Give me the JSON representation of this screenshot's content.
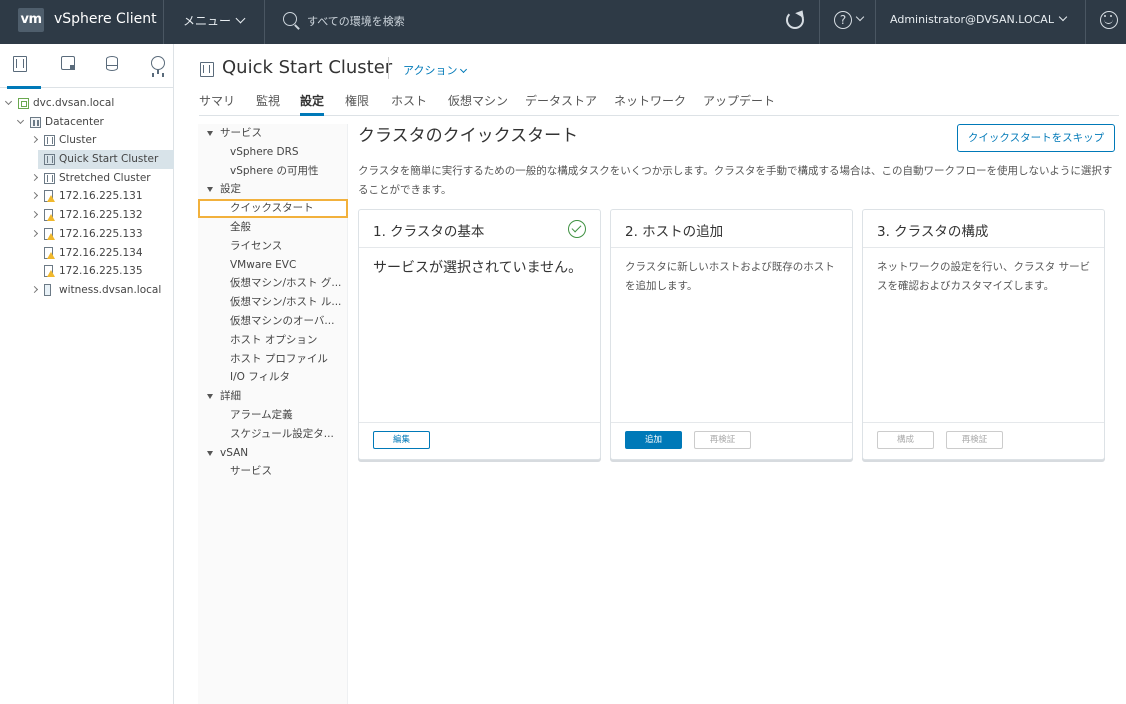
{
  "header": {
    "logo": "vm",
    "app_title": "vSphere Client",
    "menu_label": "メニュー",
    "search_placeholder": "すべての環境を検索",
    "user": "Administrator@DVSAN.LOCAL",
    "help_glyph": "?"
  },
  "navigator": {
    "tabs": [
      "hosts-and-clusters",
      "vms-and-templates",
      "storage",
      "networking"
    ],
    "tree": [
      {
        "label": "dvc.dvsan.local",
        "type": "vcenter",
        "level": 0,
        "expanded": true
      },
      {
        "label": "Datacenter",
        "type": "datacenter",
        "level": 1,
        "expanded": true
      },
      {
        "label": "Cluster",
        "type": "cluster",
        "level": 2,
        "expanded": false
      },
      {
        "label": "Quick Start Cluster",
        "type": "cluster",
        "level": 2,
        "selected": true
      },
      {
        "label": "Stretched Cluster",
        "type": "cluster",
        "level": 2,
        "expanded": false
      },
      {
        "label": "172.16.225.131",
        "type": "host-warning",
        "level": 2,
        "expanded": false
      },
      {
        "label": "172.16.225.132",
        "type": "host-warning",
        "level": 2,
        "expanded": false
      },
      {
        "label": "172.16.225.133",
        "type": "host-warning",
        "level": 2,
        "expanded": false
      },
      {
        "label": "172.16.225.134",
        "type": "host-warning",
        "level": 2
      },
      {
        "label": "172.16.225.135",
        "type": "host-warning",
        "level": 2
      },
      {
        "label": "witness.dvsan.local",
        "type": "witness",
        "level": 2,
        "expanded": false
      }
    ]
  },
  "object": {
    "title": "Quick Start Cluster",
    "actions_label": "アクション",
    "tabs": [
      "サマリ",
      "監視",
      "設定",
      "権限",
      "ホスト",
      "仮想マシン",
      "データストア",
      "ネットワーク",
      "アップデート"
    ],
    "active_tab": "設定"
  },
  "settings_nav": {
    "items": [
      {
        "label": "サービス",
        "group": true
      },
      {
        "label": "vSphere DRS"
      },
      {
        "label": "vSphere の可用性"
      },
      {
        "label": "設定",
        "group": true
      },
      {
        "label": "クイックスタート",
        "active": true
      },
      {
        "label": "全般"
      },
      {
        "label": "ライセンス"
      },
      {
        "label": "VMware EVC"
      },
      {
        "label": "仮想マシン/ホスト グ..."
      },
      {
        "label": "仮想マシン/ホスト ル..."
      },
      {
        "label": "仮想マシンのオーバ..."
      },
      {
        "label": "ホスト オプション"
      },
      {
        "label": "ホスト プロファイル"
      },
      {
        "label": "I/O フィルタ"
      },
      {
        "label": "詳細",
        "group": true
      },
      {
        "label": "アラーム定義"
      },
      {
        "label": "スケジュール設定タ..."
      },
      {
        "label": "vSAN",
        "group": true
      },
      {
        "label": "サービス"
      }
    ]
  },
  "quickstart": {
    "title": "クラスタのクイックスタート",
    "skip_button": "クイックスタートをスキップ",
    "description": "クラスタを簡単に実行するための一般的な構成タスクをいくつか示します。クラスタを手動で構成する場合は、この自動ワークフローを使用しないように選択することができます。",
    "cards": [
      {
        "title": "1. クラスタの基本",
        "completed": true,
        "body": "サービスが選択されていません。",
        "buttons": [
          {
            "label": "編集",
            "style": "outline"
          }
        ]
      },
      {
        "title": "2. ホストの追加",
        "completed": false,
        "body": "クラスタに新しいホストおよび既存のホストを追加します。",
        "buttons": [
          {
            "label": "追加",
            "style": "primary"
          },
          {
            "label": "再検証",
            "style": "disabled"
          }
        ]
      },
      {
        "title": "3. クラスタの構成",
        "completed": false,
        "body": "ネットワークの設定を行い、クラスタ サービスを確認およびカスタマイズします。",
        "buttons": [
          {
            "label": "構成",
            "style": "disabled"
          },
          {
            "label": "再検証",
            "style": "disabled"
          }
        ]
      }
    ]
  },
  "colors": {
    "header_bg": "#2e3a46",
    "accent": "#0079b8",
    "highlight_outline": "#f2b13c",
    "success": "#3f9142",
    "warning": "#f0b82d"
  }
}
